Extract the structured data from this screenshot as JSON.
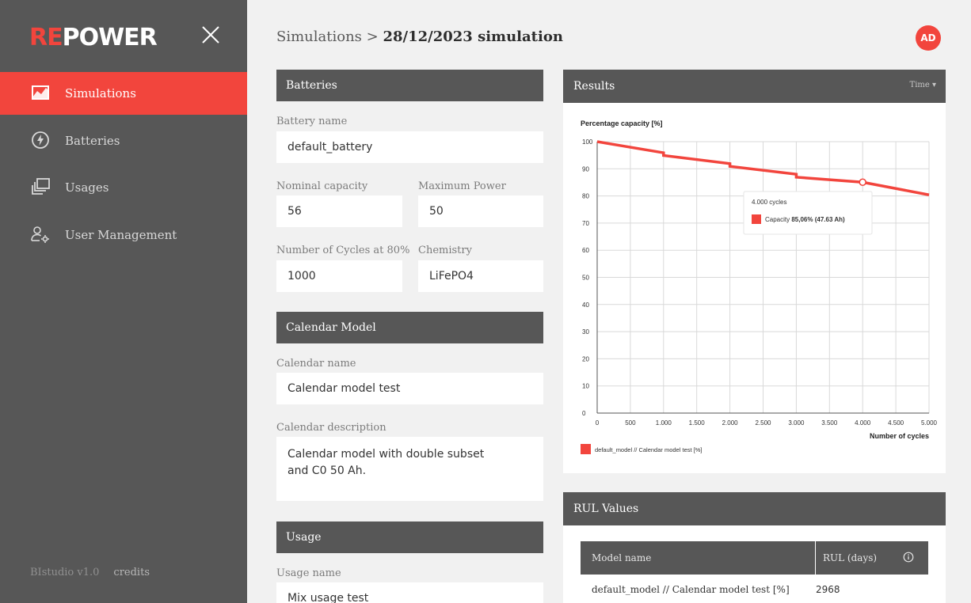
{
  "brand": {
    "logo_prefix": "RE",
    "logo_suffix": "POWER"
  },
  "sidebar": {
    "items": [
      {
        "label": "Simulations",
        "icon": "chart-area-icon",
        "active": true
      },
      {
        "label": "Batteries",
        "icon": "bolt-icon",
        "active": false
      },
      {
        "label": "Usages",
        "icon": "layers-icon",
        "active": false
      },
      {
        "label": "User Management",
        "icon": "user-gear-icon",
        "active": false
      }
    ],
    "footer": {
      "version": "BIstudio  v1.0",
      "credits": "credits"
    }
  },
  "header": {
    "breadcrumb_parent": "Simulations",
    "breadcrumb_sep": ">",
    "breadcrumb_current": "28/12/2023 simulation",
    "avatar_initials": "AD"
  },
  "batteries": {
    "title": "Batteries",
    "battery_name_label": "Battery name",
    "battery_name": "default_battery",
    "nominal_capacity_label": "Nominal capacity",
    "nominal_capacity": "56",
    "max_power_label": "Maximum Power",
    "max_power": "50",
    "cycles_label": "Number of Cycles at 80%",
    "cycles": "1000",
    "chemistry_label": "Chemistry",
    "chemistry": "LiFePO4"
  },
  "calendar": {
    "title": "Calendar Model",
    "name_label": "Calendar name",
    "name": "Calendar model test",
    "description_label": "Calendar description",
    "description": "Calendar model with double subset and C0 50 Ah."
  },
  "usage": {
    "title": "Usage",
    "name_label": "Usage name",
    "name": "Mix usage test"
  },
  "results": {
    "title": "Results",
    "time_dropdown": "Time ▾"
  },
  "chart_data": {
    "type": "line",
    "title": "",
    "ylabel": "Percentage capacity [%]",
    "xlabel": "Number of cycles",
    "ylim": [
      0,
      100
    ],
    "xlim": [
      0,
      5000
    ],
    "yticks": [
      0,
      10,
      20,
      30,
      40,
      50,
      60,
      70,
      80,
      90,
      100
    ],
    "xticks": [
      0,
      500,
      1000,
      1500,
      2000,
      2500,
      3000,
      3500,
      4000,
      4500,
      5000
    ],
    "xtick_labels": [
      "0",
      "500",
      "1.000",
      "1.500",
      "2.000",
      "2.500",
      "3.000",
      "3.500",
      "4.000",
      "4.500",
      "5.000"
    ],
    "grid": true,
    "color": "#f2453d",
    "series": [
      {
        "name": "default_model // Calendar model test [%]",
        "x": [
          0,
          1000,
          1000,
          2000,
          2000,
          3000,
          3000,
          4000,
          5000
        ],
        "values": [
          100,
          95.9,
          94.9,
          91.9,
          90.9,
          88.0,
          86.9,
          85.06,
          80.4
        ]
      }
    ],
    "tooltip": {
      "x": 4000,
      "y": 85.06,
      "title": "4.000 cycles",
      "label": "Capacity",
      "value": "85,06% (47.63 Ah)"
    },
    "legend_position": "bottom-left"
  },
  "rul": {
    "title": "RUL Values",
    "col_model": "Model name",
    "col_rul": "RUL (days)",
    "rows": [
      {
        "model": "default_model // Calendar model test [%]",
        "rul": "2968"
      }
    ]
  }
}
